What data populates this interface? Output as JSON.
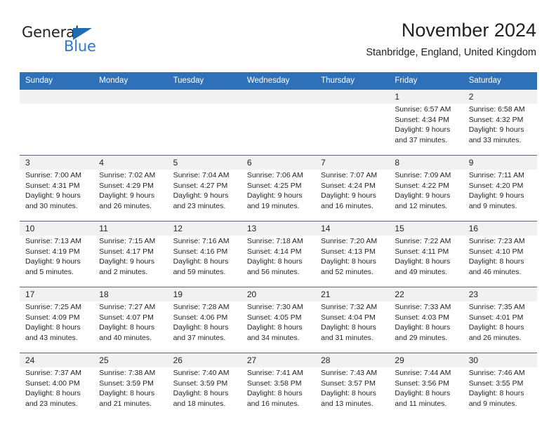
{
  "logo": {
    "text_primary": "General",
    "text_secondary": "Blue",
    "primary_color": "#231f20",
    "secondary_color": "#2e79c6",
    "triangle_color": "#1f6cb0"
  },
  "header": {
    "title": "November 2024",
    "location": "Stanbridge, England, United Kingdom"
  },
  "theme": {
    "header_blue": "#2e71b8",
    "daynum_band": "#f1f1f1",
    "cell_background": "#ffffff",
    "text_color": "#231f20"
  },
  "calendar": {
    "weekday_headers": [
      "Sunday",
      "Monday",
      "Tuesday",
      "Wednesday",
      "Thursday",
      "Friday",
      "Saturday"
    ],
    "weeks": [
      [
        {
          "day": "",
          "lines": []
        },
        {
          "day": "",
          "lines": []
        },
        {
          "day": "",
          "lines": []
        },
        {
          "day": "",
          "lines": []
        },
        {
          "day": "",
          "lines": []
        },
        {
          "day": "1",
          "lines": [
            "Sunrise: 6:57 AM",
            "Sunset: 4:34 PM",
            "Daylight: 9 hours",
            "and 37 minutes."
          ]
        },
        {
          "day": "2",
          "lines": [
            "Sunrise: 6:58 AM",
            "Sunset: 4:32 PM",
            "Daylight: 9 hours",
            "and 33 minutes."
          ]
        }
      ],
      [
        {
          "day": "3",
          "lines": [
            "Sunrise: 7:00 AM",
            "Sunset: 4:31 PM",
            "Daylight: 9 hours",
            "and 30 minutes."
          ]
        },
        {
          "day": "4",
          "lines": [
            "Sunrise: 7:02 AM",
            "Sunset: 4:29 PM",
            "Daylight: 9 hours",
            "and 26 minutes."
          ]
        },
        {
          "day": "5",
          "lines": [
            "Sunrise: 7:04 AM",
            "Sunset: 4:27 PM",
            "Daylight: 9 hours",
            "and 23 minutes."
          ]
        },
        {
          "day": "6",
          "lines": [
            "Sunrise: 7:06 AM",
            "Sunset: 4:25 PM",
            "Daylight: 9 hours",
            "and 19 minutes."
          ]
        },
        {
          "day": "7",
          "lines": [
            "Sunrise: 7:07 AM",
            "Sunset: 4:24 PM",
            "Daylight: 9 hours",
            "and 16 minutes."
          ]
        },
        {
          "day": "8",
          "lines": [
            "Sunrise: 7:09 AM",
            "Sunset: 4:22 PM",
            "Daylight: 9 hours",
            "and 12 minutes."
          ]
        },
        {
          "day": "9",
          "lines": [
            "Sunrise: 7:11 AM",
            "Sunset: 4:20 PM",
            "Daylight: 9 hours",
            "and 9 minutes."
          ]
        }
      ],
      [
        {
          "day": "10",
          "lines": [
            "Sunrise: 7:13 AM",
            "Sunset: 4:19 PM",
            "Daylight: 9 hours",
            "and 5 minutes."
          ]
        },
        {
          "day": "11",
          "lines": [
            "Sunrise: 7:15 AM",
            "Sunset: 4:17 PM",
            "Daylight: 9 hours",
            "and 2 minutes."
          ]
        },
        {
          "day": "12",
          "lines": [
            "Sunrise: 7:16 AM",
            "Sunset: 4:16 PM",
            "Daylight: 8 hours",
            "and 59 minutes."
          ]
        },
        {
          "day": "13",
          "lines": [
            "Sunrise: 7:18 AM",
            "Sunset: 4:14 PM",
            "Daylight: 8 hours",
            "and 56 minutes."
          ]
        },
        {
          "day": "14",
          "lines": [
            "Sunrise: 7:20 AM",
            "Sunset: 4:13 PM",
            "Daylight: 8 hours",
            "and 52 minutes."
          ]
        },
        {
          "day": "15",
          "lines": [
            "Sunrise: 7:22 AM",
            "Sunset: 4:11 PM",
            "Daylight: 8 hours",
            "and 49 minutes."
          ]
        },
        {
          "day": "16",
          "lines": [
            "Sunrise: 7:23 AM",
            "Sunset: 4:10 PM",
            "Daylight: 8 hours",
            "and 46 minutes."
          ]
        }
      ],
      [
        {
          "day": "17",
          "lines": [
            "Sunrise: 7:25 AM",
            "Sunset: 4:09 PM",
            "Daylight: 8 hours",
            "and 43 minutes."
          ]
        },
        {
          "day": "18",
          "lines": [
            "Sunrise: 7:27 AM",
            "Sunset: 4:07 PM",
            "Daylight: 8 hours",
            "and 40 minutes."
          ]
        },
        {
          "day": "19",
          "lines": [
            "Sunrise: 7:28 AM",
            "Sunset: 4:06 PM",
            "Daylight: 8 hours",
            "and 37 minutes."
          ]
        },
        {
          "day": "20",
          "lines": [
            "Sunrise: 7:30 AM",
            "Sunset: 4:05 PM",
            "Daylight: 8 hours",
            "and 34 minutes."
          ]
        },
        {
          "day": "21",
          "lines": [
            "Sunrise: 7:32 AM",
            "Sunset: 4:04 PM",
            "Daylight: 8 hours",
            "and 31 minutes."
          ]
        },
        {
          "day": "22",
          "lines": [
            "Sunrise: 7:33 AM",
            "Sunset: 4:03 PM",
            "Daylight: 8 hours",
            "and 29 minutes."
          ]
        },
        {
          "day": "23",
          "lines": [
            "Sunrise: 7:35 AM",
            "Sunset: 4:01 PM",
            "Daylight: 8 hours",
            "and 26 minutes."
          ]
        }
      ],
      [
        {
          "day": "24",
          "lines": [
            "Sunrise: 7:37 AM",
            "Sunset: 4:00 PM",
            "Daylight: 8 hours",
            "and 23 minutes."
          ]
        },
        {
          "day": "25",
          "lines": [
            "Sunrise: 7:38 AM",
            "Sunset: 3:59 PM",
            "Daylight: 8 hours",
            "and 21 minutes."
          ]
        },
        {
          "day": "26",
          "lines": [
            "Sunrise: 7:40 AM",
            "Sunset: 3:59 PM",
            "Daylight: 8 hours",
            "and 18 minutes."
          ]
        },
        {
          "day": "27",
          "lines": [
            "Sunrise: 7:41 AM",
            "Sunset: 3:58 PM",
            "Daylight: 8 hours",
            "and 16 minutes."
          ]
        },
        {
          "day": "28",
          "lines": [
            "Sunrise: 7:43 AM",
            "Sunset: 3:57 PM",
            "Daylight: 8 hours",
            "and 13 minutes."
          ]
        },
        {
          "day": "29",
          "lines": [
            "Sunrise: 7:44 AM",
            "Sunset: 3:56 PM",
            "Daylight: 8 hours",
            "and 11 minutes."
          ]
        },
        {
          "day": "30",
          "lines": [
            "Sunrise: 7:46 AM",
            "Sunset: 3:55 PM",
            "Daylight: 8 hours",
            "and 9 minutes."
          ]
        }
      ]
    ]
  }
}
